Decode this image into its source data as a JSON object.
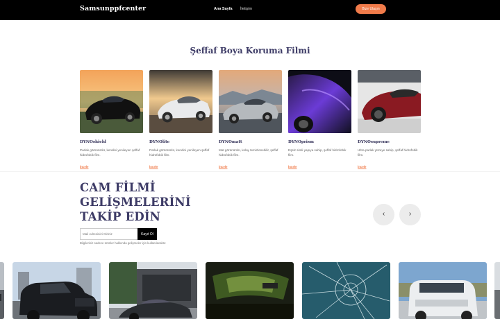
{
  "nav": {
    "brand": "Samsunppfcenter",
    "links": [
      "Ana Sayfa",
      "İletişim"
    ],
    "cta": "Bize Ulaşın"
  },
  "section1": {
    "title": "Şeffaf Boya Koruma Filmi",
    "cards": [
      {
        "name": "DYNOshield",
        "desc": "Parlak görünümlü, kendini yenileyen şeffaf hidrofobik film.",
        "link": "İncele"
      },
      {
        "name": "DYNOlite",
        "desc": "Parlak görünümlü, kendini yenileyen şeffaf hidrofobik film.",
        "link": "İncele"
      },
      {
        "name": "DYNOmatt",
        "desc": "Mat görünümlü, kolay temizlenebilir, şeffaf hidrofobik film.",
        "link": "İncele"
      },
      {
        "name": "DYNOprism",
        "desc": "Eşsiz simli yapıya sahip, şeffaf hidrofobik film.",
        "link": "İncele"
      },
      {
        "name": "DYNOsupreme",
        "desc": "Ultra parlak yüzeye sahip, şeffaf hidrofobik film.",
        "link": "İncele"
      }
    ]
  },
  "section2": {
    "headline": "CAM FİLMİ GELİŞMELERİNİ TAKİP EDİN",
    "input_placeholder": "Mail Adresinizi Giriniz",
    "button": "Kayıt Ol",
    "note": "Bilgileriniz sadece ürünler hakkında gelişmeler için kullanılacaktır.",
    "prev_glyph": "‹",
    "next_glyph": "›"
  }
}
